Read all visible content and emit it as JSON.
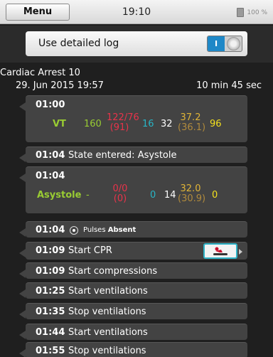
{
  "statusbar": {
    "menu_label": "Menu",
    "time": "19:10",
    "battery_text": "100 %"
  },
  "logbar": {
    "label": "Use detailed log",
    "toggle_on_label": "I"
  },
  "case": {
    "name": "Cardiac Arrest 10",
    "date": "29. Jun 2015 19:57",
    "duration": "10 min 45 sec"
  },
  "colors": {
    "rhythm": "#99cc33",
    "bp": "#e8334a",
    "spo2": "#28b5c6",
    "temp": "#e0b437",
    "etco2": "#f3e01e",
    "cpr_border": "#2fb3c7",
    "toggle_on": "#1f88c7"
  },
  "entries": {
    "e1": {
      "time": "01:00",
      "rhythm": "VT",
      "hr": "160",
      "bp": "122/76",
      "bp_mean": "(91)",
      "spo2": "16",
      "rr": "32",
      "temp": "37.2",
      "temp2": "(36.1)",
      "etco2": "96"
    },
    "e2": {
      "time": "01:04",
      "text": "State entered: Asystole"
    },
    "e3": {
      "time": "01:04",
      "rhythm": "Asystole",
      "hr": "-",
      "bp": "0/0",
      "bp_mean": "(0)",
      "spo2": "0",
      "rr": "14",
      "temp": "32.0",
      "temp2": "(30.9)",
      "etco2": "0"
    },
    "e4": {
      "time": "01:04",
      "pulse_prefix": "Pulses",
      "pulse_state": "Absent"
    },
    "e5": {
      "time": "01:09",
      "text": "Start CPR"
    },
    "e6": {
      "time": "01:09",
      "text": "Start compressions"
    },
    "e7": {
      "time": "01:25",
      "text": "Start ventilations"
    },
    "e8": {
      "time": "01:35",
      "text": "Stop ventilations"
    },
    "e9": {
      "time": "01:44",
      "text": "Start ventilations"
    },
    "e10": {
      "time": "01:55",
      "text": "Stop ventilations"
    }
  }
}
